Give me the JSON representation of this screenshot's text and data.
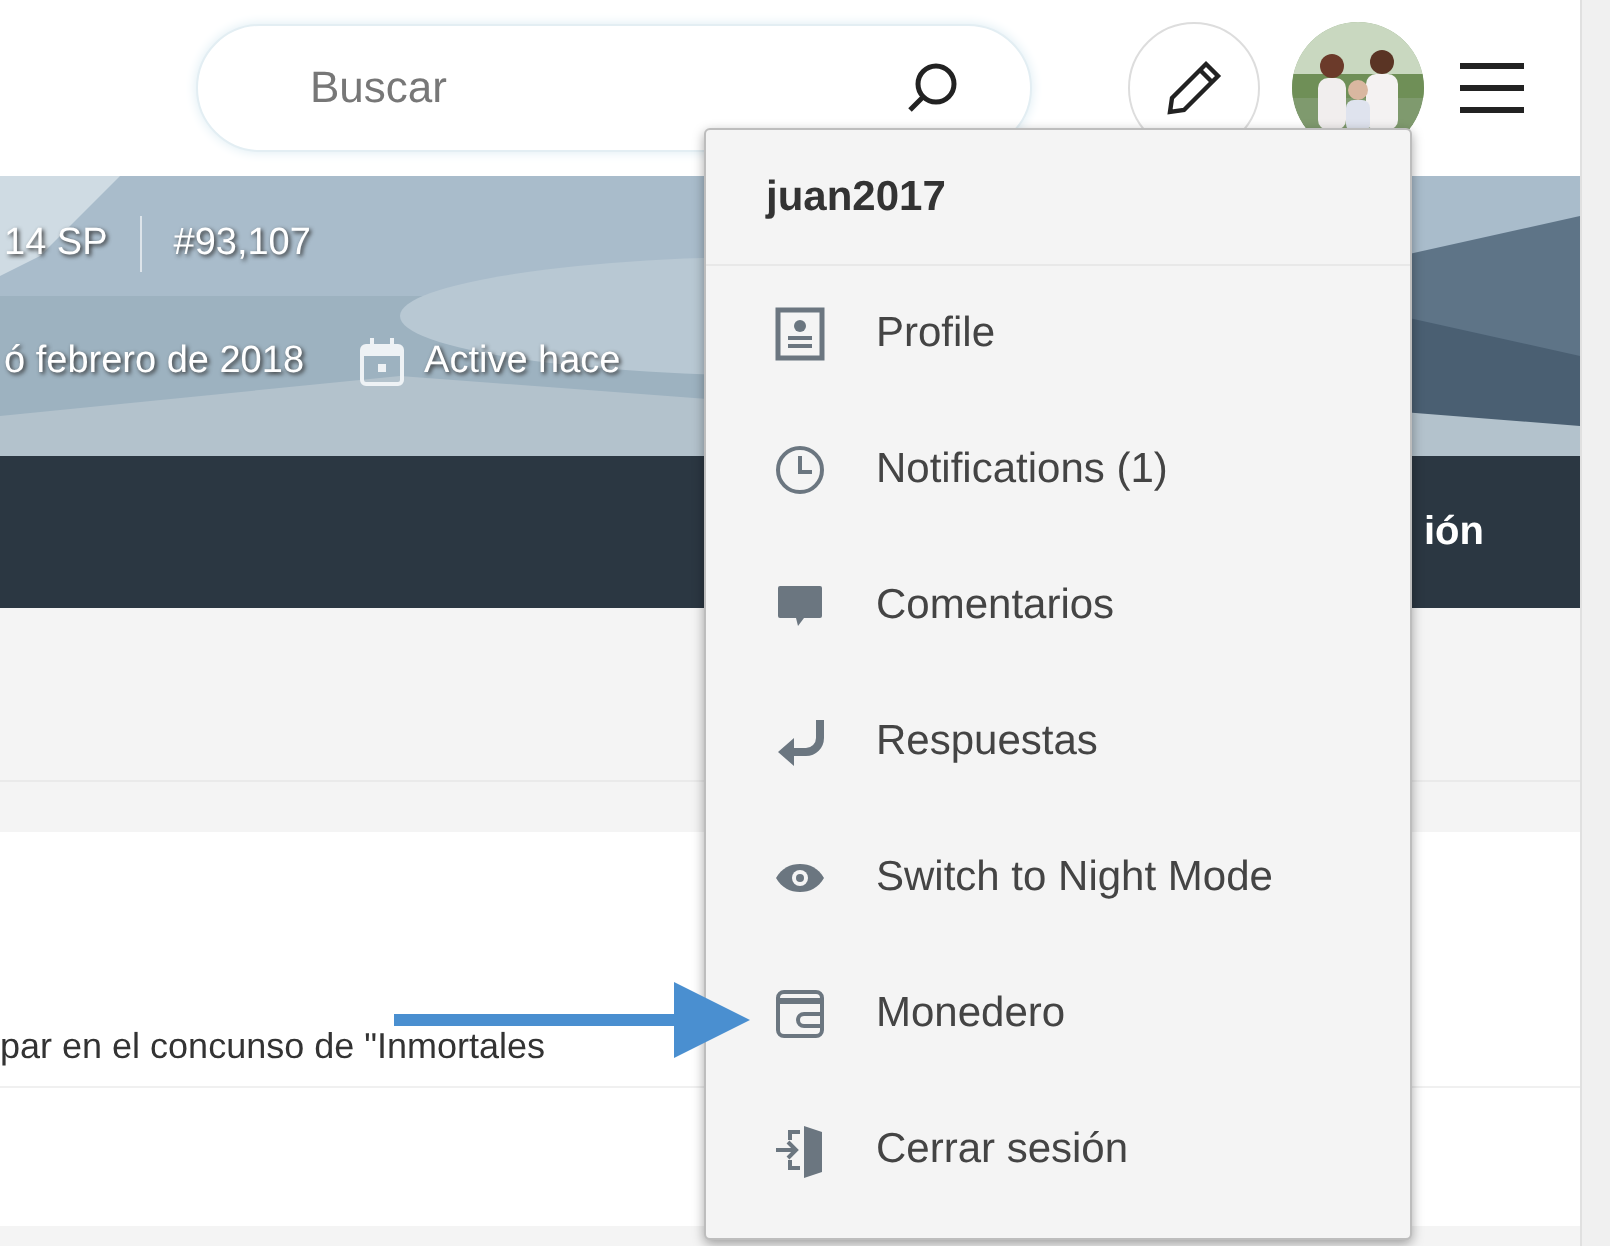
{
  "header": {
    "search": {
      "placeholder": "Buscar"
    }
  },
  "banner": {
    "stats": [
      "14 SP",
      "#93,107"
    ],
    "joined": "ó febrero de 2018",
    "active": "Active hace"
  },
  "nav": {
    "tab": "ión"
  },
  "post": {
    "text": "par en el concunso de \"Inmortales"
  },
  "user_menu": {
    "username": "juan2017",
    "items": [
      {
        "kind": "profile",
        "label": "Profile"
      },
      {
        "kind": "clock",
        "label": "Notifications (1)"
      },
      {
        "kind": "comment",
        "label": "Comentarios"
      },
      {
        "kind": "reply",
        "label": "Respuestas"
      },
      {
        "kind": "eye",
        "label": "Switch to Night Mode"
      },
      {
        "kind": "wallet",
        "label": "Monedero"
      },
      {
        "kind": "logout",
        "label": "Cerrar sesión"
      }
    ]
  }
}
